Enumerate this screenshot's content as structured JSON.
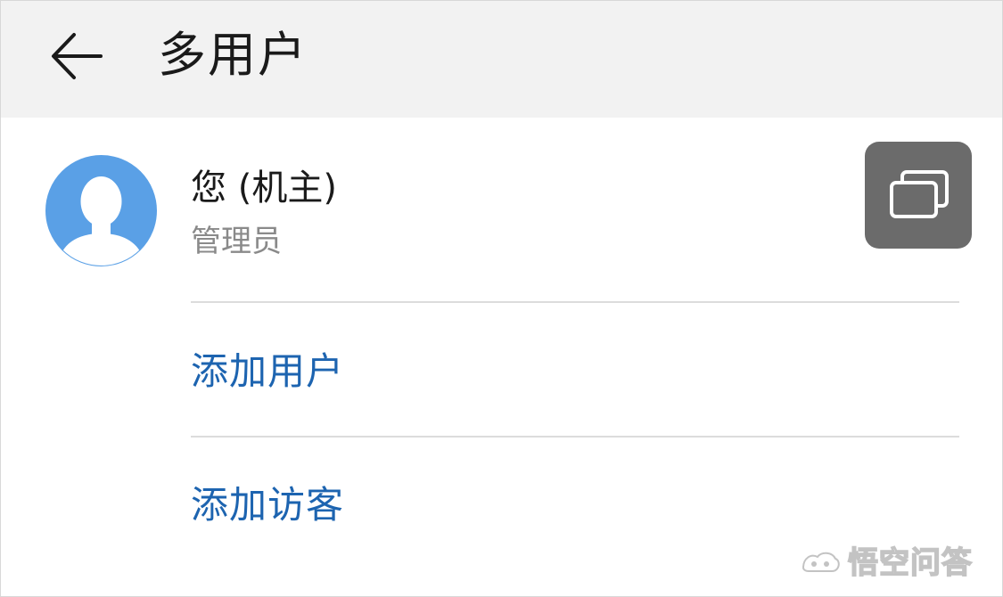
{
  "header": {
    "title": "多用户",
    "back_icon": "arrow-left-icon"
  },
  "owner": {
    "name": "您 (机主)",
    "role": "管理员",
    "avatar_icon": "person-silhouette-icon",
    "avatar_color": "#5aa0e6",
    "switch_icon": "switch-user-icon",
    "switch_color": "#6b6b6b"
  },
  "actions": [
    {
      "label": "添加用户"
    },
    {
      "label": "添加访客"
    }
  ],
  "colors": {
    "accent": "#1d64b0",
    "header_bg": "#f2f2f2",
    "secondary_text": "#8a8a8a"
  },
  "watermark": {
    "text": "悟空问答",
    "icon": "wukong-logo-icon"
  }
}
